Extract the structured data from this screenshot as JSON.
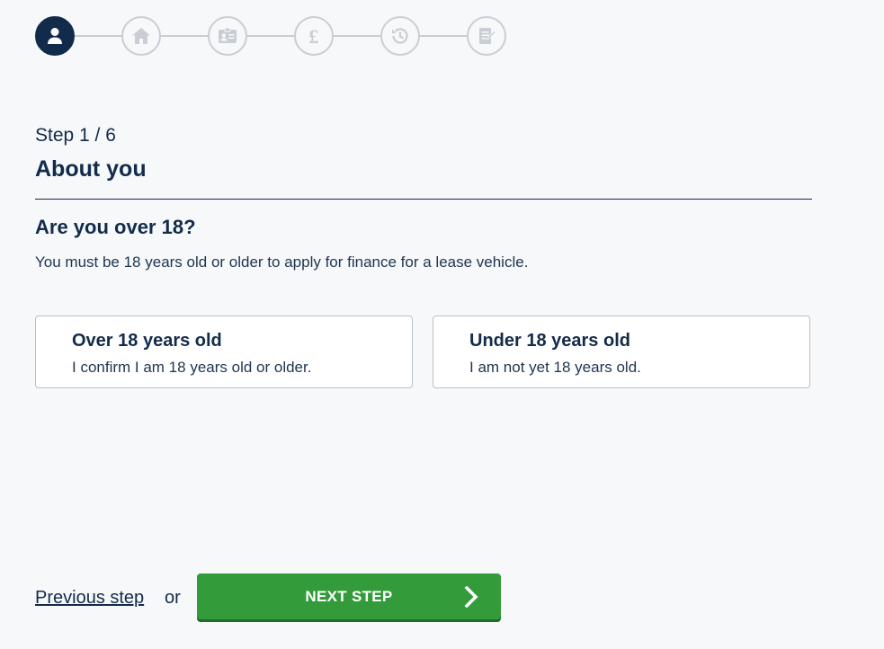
{
  "stepper": {
    "steps": [
      {
        "icon": "user-icon",
        "active": true
      },
      {
        "icon": "home-icon",
        "active": false
      },
      {
        "icon": "id-card-icon",
        "active": false
      },
      {
        "icon": "pound-icon",
        "active": false
      },
      {
        "icon": "history-icon",
        "active": false
      },
      {
        "icon": "document-edit-icon",
        "active": false
      }
    ]
  },
  "header": {
    "step_label": "Step 1 / 6",
    "title": "About you"
  },
  "question": {
    "title": "Are you over 18?",
    "description": "You must be 18 years old or older to apply for finance for a lease vehicle."
  },
  "options": [
    {
      "title": "Over 18 years old",
      "subtitle": "I confirm I am 18 years old or older."
    },
    {
      "title": "Under 18 years old",
      "subtitle": "I am not yet 18 years old."
    }
  ],
  "footer": {
    "previous_label": "Previous step",
    "or_label": "or",
    "next_label": "NEXT STEP"
  },
  "colors": {
    "primary": "#132b4a",
    "accent_green": "#339b3a",
    "inactive": "#c9ced4",
    "background": "#f6f8fa"
  }
}
